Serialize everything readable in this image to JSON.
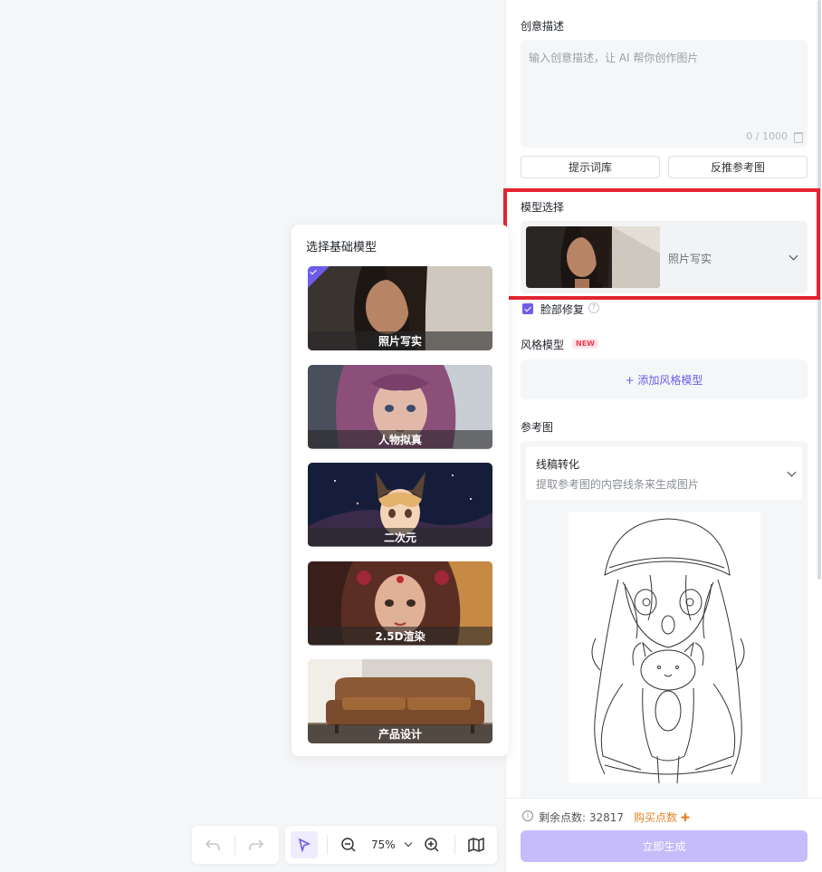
{
  "prompt": {
    "label": "创意描述",
    "placeholder": "输入创意描述，让 AI 帮你创作图片",
    "counter": "0 / 1000",
    "buttons": [
      "提示词库",
      "反推参考图"
    ]
  },
  "model_select": {
    "label": "模型选择",
    "selected": "照片写实",
    "face_fix": "脸部修复"
  },
  "style_model": {
    "label": "风格模型",
    "badge": "NEW",
    "add_label": "+ 添加风格模型"
  },
  "reference": {
    "label": "参考图",
    "mode_title": "线稿转化",
    "mode_desc": "提取参考图的内容线条来生成图片"
  },
  "footer": {
    "points": "剩余点数: 32817",
    "buy": "购买点数",
    "generate": "立即生成"
  },
  "popup": {
    "title": "选择基础模型",
    "options": [
      {
        "label": "照片写实"
      },
      {
        "label": "人物拟真"
      },
      {
        "label": "二次元"
      },
      {
        "label": "2.5D渲染"
      },
      {
        "label": "产品设计"
      }
    ]
  },
  "toolbar": {
    "zoom": "75%"
  },
  "colors": {
    "accent": "#6f5ce8",
    "highlight": "#e5232f",
    "buy": "#e0852a"
  }
}
